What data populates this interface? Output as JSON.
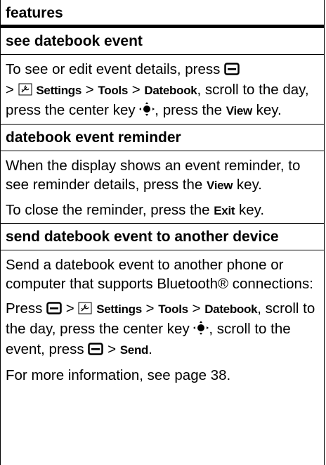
{
  "header": {
    "title": "features"
  },
  "sections": [
    {
      "title": "see datebook event"
    },
    {
      "title": "datebook event reminder"
    },
    {
      "title": "send datebook event to another device"
    }
  ],
  "text": {
    "s1_p1_a": "To see or edit event details, press ",
    "s1_p1_b": " > ",
    "s1_p1_c": " > ",
    "s1_p1_d": " > ",
    "s1_p1_e": ", scroll to the day, press the center key ",
    "s1_p1_f": ", press the ",
    "s1_p1_g": " key.",
    "s2_p1_a": "When the display shows an event reminder, to see reminder details, press the ",
    "s2_p1_b": " key.",
    "s2_p2_a": "To close the reminder, press the ",
    "s2_p2_b": " key.",
    "s3_p1": "Send a datebook event to another phone or computer that supports Bluetooth® connections:",
    "s3_p2_a": "Press ",
    "s3_p2_b": " > ",
    "s3_p2_c": " > ",
    "s3_p2_d": " > ",
    "s3_p2_e": ", scroll to the day, press the center key ",
    "s3_p2_f": ", scroll to the event, press ",
    "s3_p2_g": " > ",
    "s3_p2_h": ".",
    "s3_p3": "For more information, see page 38."
  },
  "keys": {
    "settings": "Settings",
    "tools": "Tools",
    "datebook": "Datebook",
    "view": "View",
    "exit": "Exit",
    "send": "Send"
  },
  "icons": {
    "menu_key": "menu-key-icon",
    "settings": "settings-icon",
    "center_key": "navigation-center-key-icon"
  }
}
